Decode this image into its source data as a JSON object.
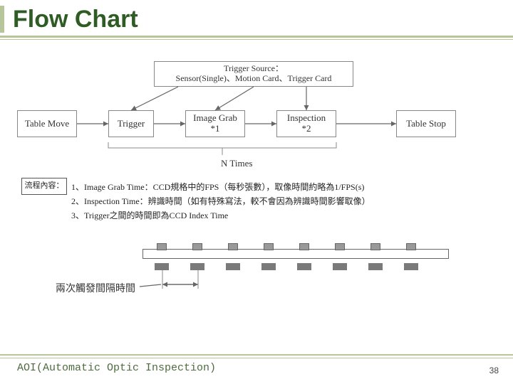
{
  "title": "Flow Chart",
  "trigger_source": {
    "line1": "Trigger Source：",
    "line2": "Sensor(Single)、Motion Card、Trigger Card"
  },
  "flow": {
    "table_move": "Table Move",
    "trigger": "Trigger",
    "image_grab_l1": "Image Grab",
    "image_grab_l2": "*1",
    "inspection_l1": "Inspection",
    "inspection_l2": "*2",
    "table_stop": "Table Stop",
    "n_times": "N Times"
  },
  "notes": {
    "header": "流程內容：",
    "item1": "1、Image Grab Time：CCD規格中的FPS（每秒張數），取像時間約略為1/FPS(s)",
    "item2": "2、Inspection Time：辨識時間（如有特殊寫法，較不會因為辨識時間影響取像）",
    "item3": "3、Trigger之間的時間即為CCD Index Time"
  },
  "interval_label": "兩次觸發間隔時間",
  "footer": "AOI(Automatic Optic Inspection)",
  "page": "38"
}
